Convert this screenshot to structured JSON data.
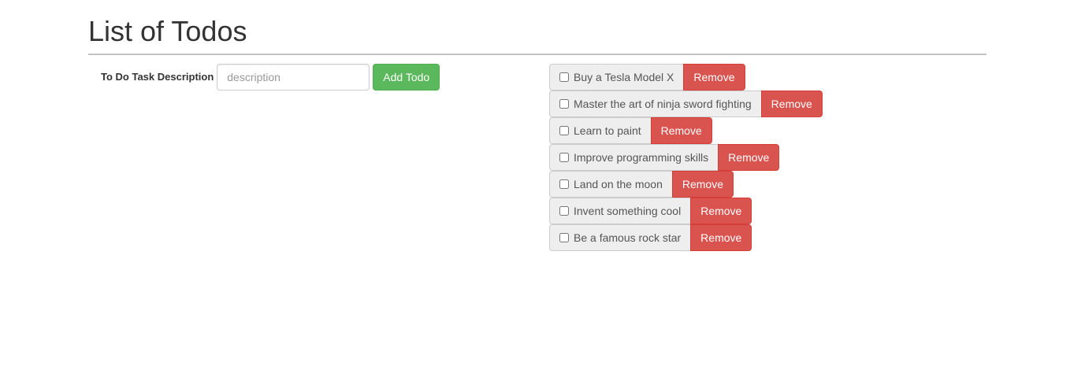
{
  "header": {
    "title": "List of Todos"
  },
  "form": {
    "label": "To Do Task Description",
    "input_placeholder": "description",
    "input_value": "",
    "add_button_label": "Add Todo"
  },
  "todos": [
    {
      "text": "Buy a Tesla Model X",
      "checked": false,
      "remove_label": "Remove"
    },
    {
      "text": "Master the art of ninja sword fighting",
      "checked": false,
      "remove_label": "Remove"
    },
    {
      "text": "Learn to paint",
      "checked": false,
      "remove_label": "Remove"
    },
    {
      "text": "Improve programming skills",
      "checked": false,
      "remove_label": "Remove"
    },
    {
      "text": "Land on the moon",
      "checked": false,
      "remove_label": "Remove"
    },
    {
      "text": "Invent something cool",
      "checked": false,
      "remove_label": "Remove"
    },
    {
      "text": "Be a famous rock star",
      "checked": false,
      "remove_label": "Remove"
    }
  ],
  "colors": {
    "add_button": "#5cb85c",
    "remove_button": "#d9534f",
    "todo_background": "#eeeeee"
  }
}
